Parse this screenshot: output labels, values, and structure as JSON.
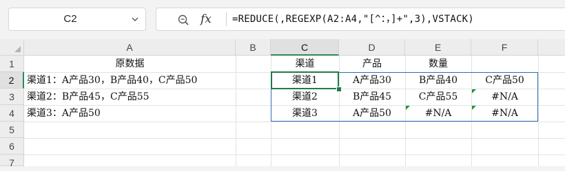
{
  "formula_bar": {
    "name_box": "C2",
    "fx_label": "fx",
    "formula": "=REDUCE(,REGEXP(A2:A4,\"[^：，]+\",3),VSTACK)"
  },
  "columns": [
    "A",
    "B",
    "C",
    "D",
    "E",
    "F"
  ],
  "selected_column": "C",
  "rows": [
    "1",
    "2",
    "3",
    "4",
    "5",
    "6",
    "7"
  ],
  "selected_row": "2",
  "cells": {
    "A1": "原数据",
    "A2": "渠道1：A产品30，B产品40，C产品50",
    "A3": "渠道2：B产品45，C产品55",
    "A4": "渠道3：A产品50",
    "C1": "渠道",
    "D1": "产品",
    "E1": "数量",
    "C2": "渠道1",
    "D2": "A产品30",
    "E2": "B产品40",
    "F2": "C产品50",
    "C3": "渠道2",
    "D3": "B产品45",
    "E3": "C产品55",
    "F3": "#N/A",
    "C4": "渠道3",
    "D4": "A产品50",
    "E4": "#N/A",
    "F4": "#N/A"
  },
  "colors": {
    "accent_green": "#1f7a46",
    "spill_border": "#2f6ab8",
    "error_flag": "#1a9a3a"
  }
}
